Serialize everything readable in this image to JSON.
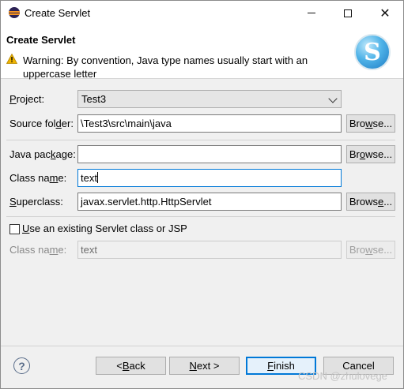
{
  "window": {
    "title": "Create Servlet"
  },
  "header": {
    "title": "Create Servlet",
    "warning": "Warning: By convention, Java type names usually start with an uppercase letter"
  },
  "form": {
    "project": {
      "label_pre": "",
      "label_ul": "P",
      "label_post": "roject:",
      "value": "Test3"
    },
    "source_folder": {
      "label_pre": "Source fol",
      "label_ul": "d",
      "label_post": "er:",
      "value": "\\Test3\\src\\main\\java",
      "button": {
        "pre": "Bro",
        "ul": "w",
        "post": "se..."
      }
    },
    "java_package": {
      "label_pre": "Java pac",
      "label_ul": "k",
      "label_post": "age:",
      "value": "",
      "button": {
        "pre": "Br",
        "ul": "o",
        "post": "wse..."
      }
    },
    "class_name": {
      "label_pre": "Class na",
      "label_ul": "m",
      "label_post": "e:",
      "value": "text"
    },
    "superclass": {
      "label_pre": "",
      "label_ul": "S",
      "label_post": "uperclass:",
      "value": "javax.servlet.http.HttpServlet",
      "button": {
        "pre": "Brows",
        "ul": "e",
        "post": "..."
      }
    },
    "use_existing": {
      "label_pre": "",
      "label_ul": "U",
      "label_post": "se an existing Servlet class or JSP",
      "checked": false
    },
    "existing_class": {
      "label_pre": "Class na",
      "label_ul": "m",
      "label_post": "e:",
      "value": "text",
      "button": {
        "pre": "Bro",
        "ul": "w",
        "post": "se..."
      }
    }
  },
  "footer": {
    "back": {
      "pre": "< ",
      "ul": "B",
      "post": "ack"
    },
    "next": {
      "pre": "",
      "ul": "N",
      "post": "ext >"
    },
    "finish": {
      "pre": "",
      "ul": "F",
      "post": "inish"
    },
    "cancel": "Cancel",
    "help_symbol": "?"
  },
  "watermark": "CSDN @zhulovege",
  "colors": {
    "focus": "#0078d7",
    "warning": "#f0b400"
  }
}
